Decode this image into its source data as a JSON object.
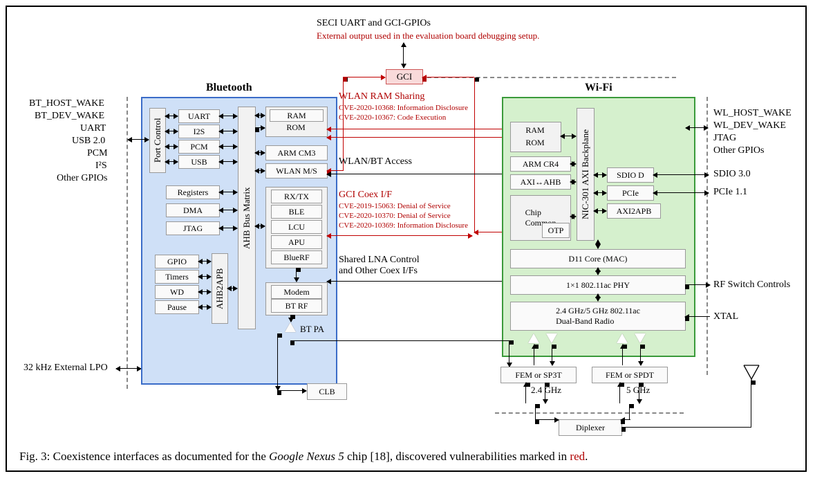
{
  "top": {
    "title": "SECI UART and GCI-GPIOs",
    "subtitle": "External output used in the evaluation board debugging setup.",
    "gci": "GCI"
  },
  "sections": {
    "bt": "Bluetooth",
    "wifi": "Wi-Fi"
  },
  "bt_left_io": [
    "BT_HOST_WAKE",
    "BT_DEV_WAKE",
    "UART",
    "USB 2.0",
    "PCM",
    "I²S",
    "Other GPIOs"
  ],
  "bt_bottom_left": "32 kHz External LPO",
  "bt": {
    "portcontrol": "Port Control",
    "ports": [
      "UART",
      "I2S",
      "PCM",
      "USB"
    ],
    "misc": [
      "Registers",
      "DMA",
      "JTAG"
    ],
    "ahb2apb": "AHB2APB",
    "apb": [
      "GPIO",
      "Timers",
      "WD",
      "Pause"
    ],
    "busmatrix": "AHB Bus Matrix",
    "right_col": [
      "RAM",
      "ROM",
      "ARM CM3",
      "WLAN M/S"
    ],
    "radio": [
      "RX/TX",
      "BLE",
      "LCU",
      "APU",
      "BlueRF"
    ],
    "modem": [
      "Modem",
      "BT RF"
    ],
    "btpa": "BT PA",
    "clb": "CLB"
  },
  "center": {
    "wlan_ram": {
      "title": "WLAN RAM Sharing",
      "lines": [
        "CVE-2020-10368:  Information  Disclosure",
        "CVE-2020-10367:  Code  Execution"
      ]
    },
    "wlan_bt_access": "WLAN/BT Access",
    "gci_coex": {
      "title": "GCI Coex I/F",
      "lines": [
        "CVE-2019-15063:  Denial   of   Service",
        "CVE-2020-10370:  Denial   of   Service",
        "CVE-2020-10369:  Information  Disclosure"
      ]
    },
    "shared_lna": "Shared LNA Control\nand Other Coex I/Fs"
  },
  "wifi": {
    "ram": "RAM",
    "rom": "ROM",
    "arm": "ARM CR4",
    "axi_ahb": "AXI↔AHB",
    "chip_common": "Chip\nCommon",
    "otp": "OTP",
    "backplane": "NIC-301  AXI Backplane",
    "sdio": "SDIO D",
    "pcie": "PCIe",
    "axi2apb": "AXI2APB",
    "d11": "D11 Core (MAC)",
    "phy": "1×1 802.11ac PHY",
    "radio": "2.4 GHz/5 GHz 802.11ac\nDual-Band Radio"
  },
  "wifi_right_io": [
    "WL_HOST_WAKE",
    "WL_DEV_WAKE",
    "JTAG",
    "Other GPIOs"
  ],
  "wifi_right_io2": {
    "sdio": "SDIO 3.0",
    "pcie": "PCIe 1.1",
    "rf": "RF Switch Controls",
    "xtal": "XTAL"
  },
  "bottom": {
    "fem1": "FEM or SP3T",
    "fem2": "FEM or SPDT",
    "g24": "2.4 GHz",
    "g5": "5 GHz",
    "diplexer": "Diplexer"
  },
  "caption": {
    "pre": "Fig. 3: Coexistence interfaces as documented for the ",
    "ital": "Google Nexus 5",
    "mid": " chip [18], discovered vulnerabilities marked in ",
    "red": "red",
    "post": "."
  }
}
